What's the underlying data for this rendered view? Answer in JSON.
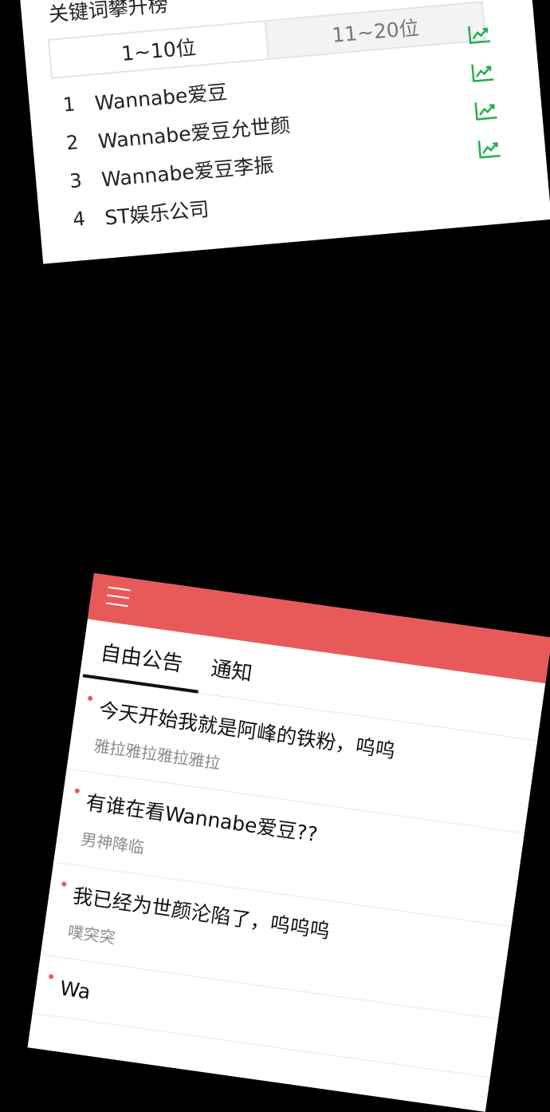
{
  "ranking": {
    "title": "关键词攀升榜",
    "tabs": [
      {
        "label": "1~10位",
        "active": true
      },
      {
        "label": "11~20位",
        "active": false
      }
    ],
    "items": [
      {
        "rank": "1",
        "term": "Wannabe爱豆",
        "trend_icon": "trend-up-icon"
      },
      {
        "rank": "2",
        "term": "Wannabe爱豆允世颜",
        "trend_icon": "trend-up-icon"
      },
      {
        "rank": "3",
        "term": "Wannabe爱豆李振",
        "trend_icon": "trend-up-icon"
      },
      {
        "rank": "4",
        "term": "ST娱乐公司",
        "trend_icon": "trend-up-icon"
      }
    ],
    "trend_color": "#22b04b"
  },
  "board": {
    "header_color": "#e85a5a",
    "menu_icon": "hamburger-menu-icon",
    "tabs": [
      {
        "label": "自由公告",
        "active": true
      },
      {
        "label": "通知",
        "active": false
      }
    ],
    "posts": [
      {
        "title": "今天开始我就是阿峰的铁粉，呜呜",
        "author": "雅拉雅拉雅拉雅拉"
      },
      {
        "title": "有谁在看Wannabe爱豆??",
        "author": "男神降临"
      },
      {
        "title": "我已经为世颜沦陷了，呜呜呜",
        "author": "噗突突"
      },
      {
        "title": "Wa",
        "author": ""
      }
    ]
  }
}
